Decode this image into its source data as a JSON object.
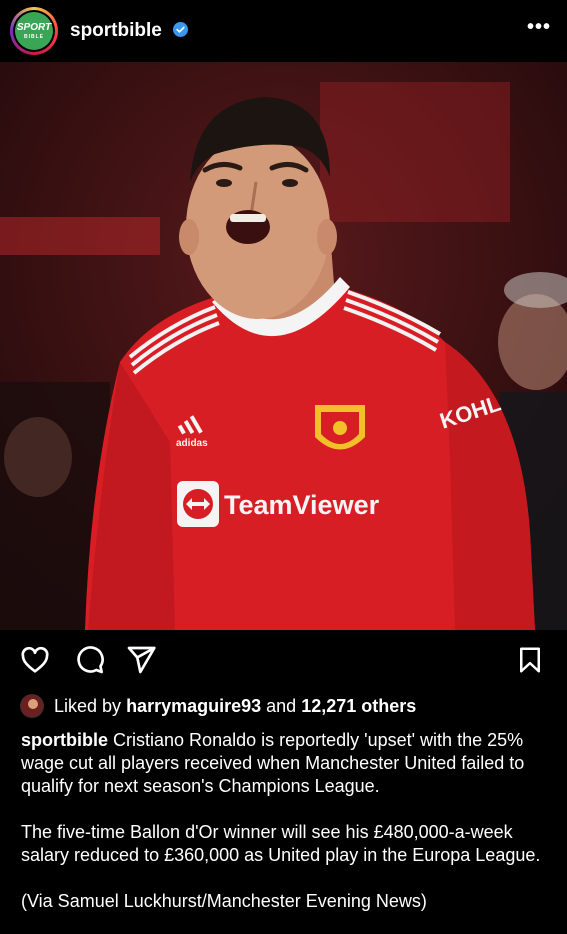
{
  "post": {
    "username": "sportbible",
    "avatar_text_top": "SPORT",
    "avatar_text_bottom": "BIBLE",
    "more_icon": "more-horizontal-icon",
    "verified_icon": "verified-badge-icon",
    "photo_shirt_brand": "TeamViewer",
    "photo_sleeve_brand": "KOHL",
    "photo_kit_brand": "adidas"
  },
  "actions": {
    "icons": [
      "heart-icon",
      "comment-icon",
      "share-icon",
      "bookmark-icon"
    ]
  },
  "likes": {
    "prefix": "Liked by",
    "user": "harrymaguire93",
    "and": "and",
    "others": "12,271 others"
  },
  "caption": {
    "author": "sportbible",
    "paragraph1": "Cristiano Ronaldo is reportedly 'upset' with the 25% wage cut all players received when Manchester United failed to qualify for next season's Champions League.",
    "paragraph2": "The five-time Ballon d'Or winner will see his £480,000-a-week salary reduced to £360,000 as United play in the Europa League.",
    "paragraph3": "(Via Samuel Luckhurst/Manchester Evening News)"
  },
  "colors": {
    "background": "#000000",
    "verified": "#3897f0",
    "shirt_red": "#d81e25"
  }
}
